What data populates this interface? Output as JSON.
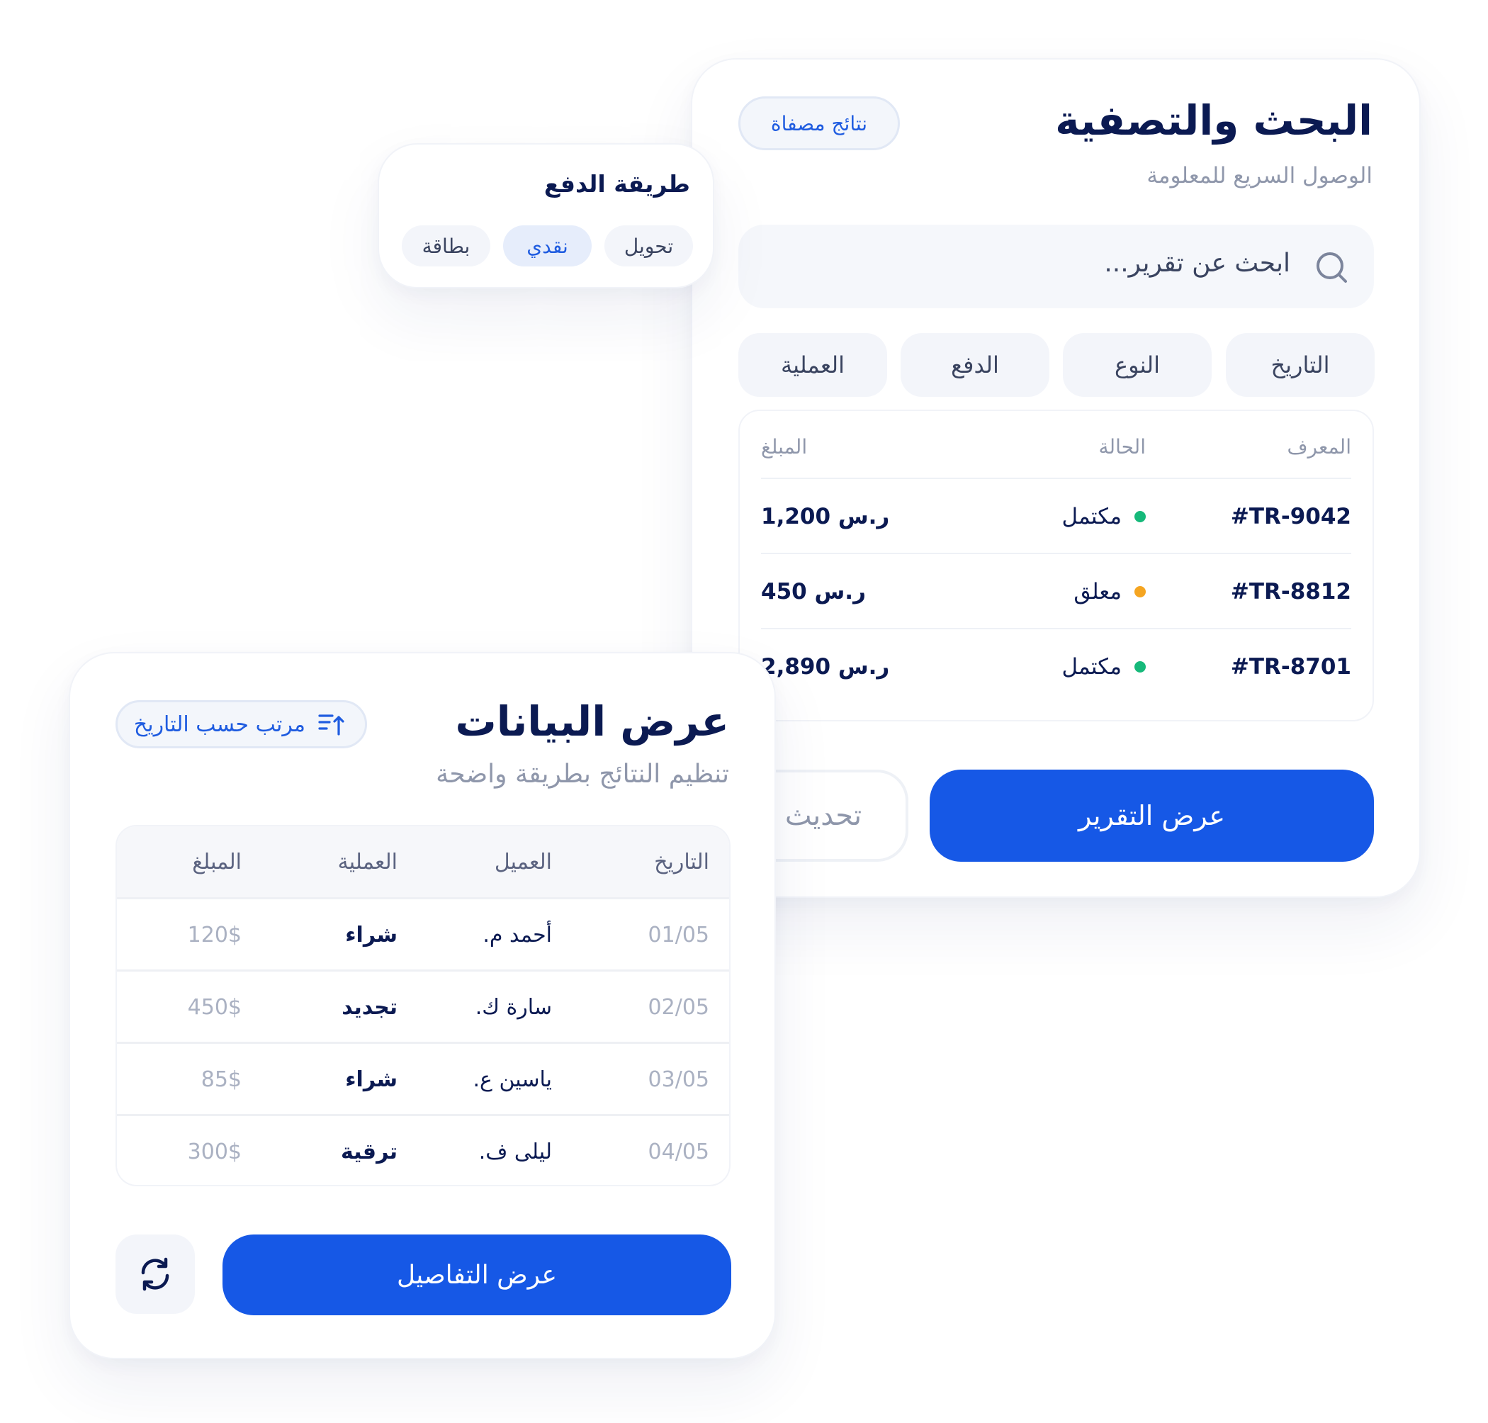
{
  "search_card": {
    "title": "البحث والتصفية",
    "subtitle": "الوصول السريع للمعلومة",
    "tag": "نتائج مصفاة",
    "search": {
      "placeholder": "ابحث عن تقرير..."
    },
    "filters": [
      "التاريخ",
      "النوع",
      "الدفع",
      "العملية"
    ],
    "table": {
      "headers": {
        "id": "المعرف",
        "status": "الحالة",
        "amount": "المبلغ"
      },
      "rows": [
        {
          "id": "#TR-9042",
          "status": "مكتمل",
          "status_color": "#16b97a",
          "amount": "1,200 ر.س"
        },
        {
          "id": "#TR-8812",
          "status": "معلق",
          "status_color": "#f5a521",
          "amount": "450 ر.س"
        },
        {
          "id": "#TR-8701",
          "status": "مكتمل",
          "status_color": "#16b97a",
          "amount": "2,890 ر.س"
        }
      ]
    },
    "primary_button": "عرض التقرير",
    "secondary_button": "تحديث"
  },
  "payment_card": {
    "title": "طريقة الدفع",
    "options": [
      {
        "label": "تحويل",
        "active": false
      },
      {
        "label": "نقدي",
        "active": true
      },
      {
        "label": "بطاقة",
        "active": false
      }
    ]
  },
  "data_card": {
    "title": "عرض البيانات",
    "subtitle": "تنظيم النتائج بطريقة واضحة",
    "sort_tag": "مرتب حسب التاريخ",
    "sort_icon": "sort-ascending-icon",
    "table": {
      "headers": {
        "date": "التاريخ",
        "client": "العميل",
        "operation": "العملية",
        "amount": "المبلغ"
      },
      "rows": [
        {
          "date": "01/05",
          "client": "أحمد م.",
          "operation": "شراء",
          "amount": "120$"
        },
        {
          "date": "02/05",
          "client": "سارة ك.",
          "operation": "تجديد",
          "amount": "450$"
        },
        {
          "date": "03/05",
          "client": "ياسين ع.",
          "operation": "شراء",
          "amount": "85$"
        },
        {
          "date": "04/05",
          "client": "ليلى ف.",
          "operation": "ترقية",
          "amount": "300$"
        }
      ]
    },
    "primary_button": "عرض التفاصيل",
    "refresh_icon": "refresh-icon"
  },
  "colors": {
    "primary": "#1658e6",
    "heading": "#0b1a52",
    "muted": "#8f97ab",
    "success": "#16b97a",
    "pending": "#f5a521"
  }
}
